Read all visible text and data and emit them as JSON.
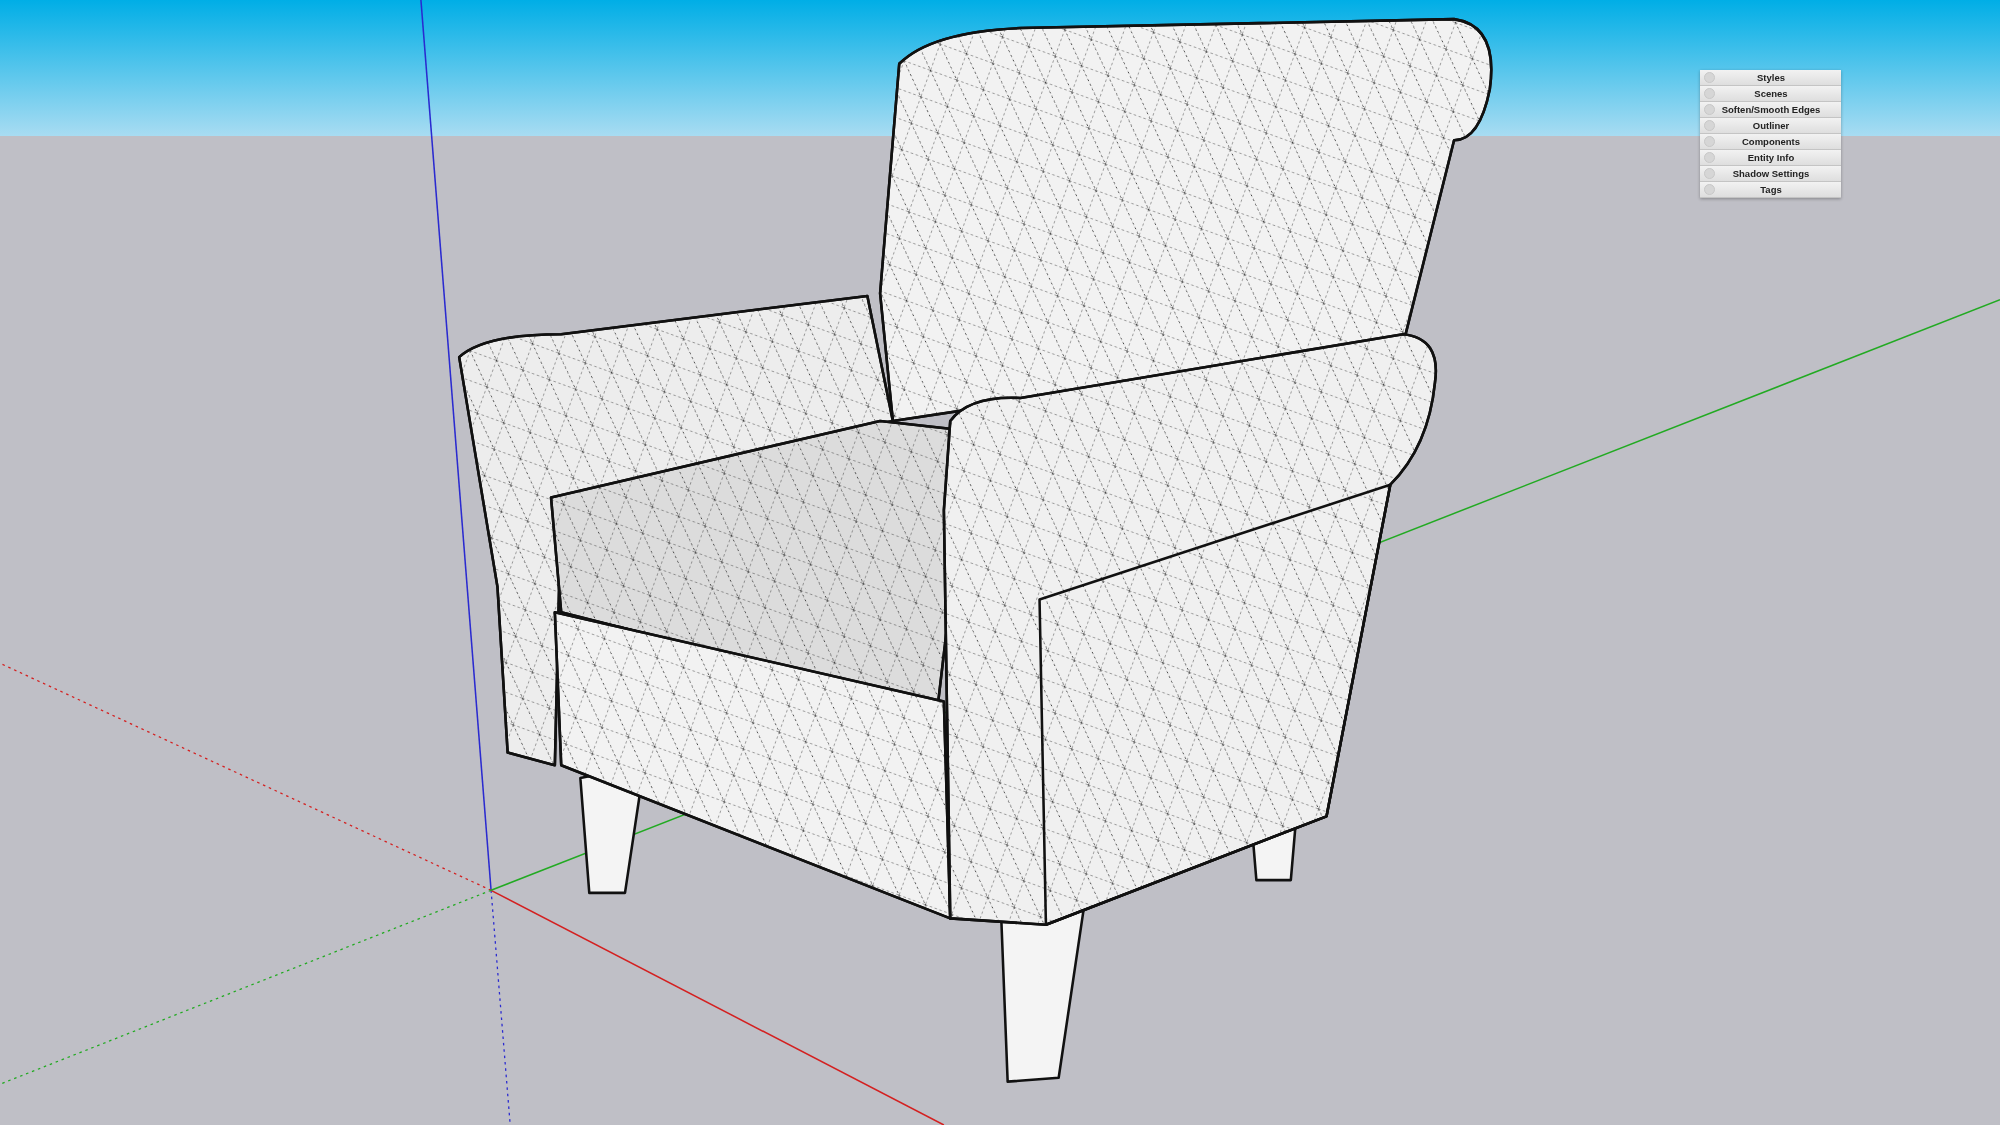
{
  "tray": {
    "panels": [
      {
        "title": "Styles"
      },
      {
        "title": "Scenes"
      },
      {
        "title": "Soften/Smooth Edges"
      },
      {
        "title": "Outliner"
      },
      {
        "title": "Components"
      },
      {
        "title": "Entity Info"
      },
      {
        "title": "Shadow Settings"
      },
      {
        "title": "Tags"
      }
    ]
  }
}
